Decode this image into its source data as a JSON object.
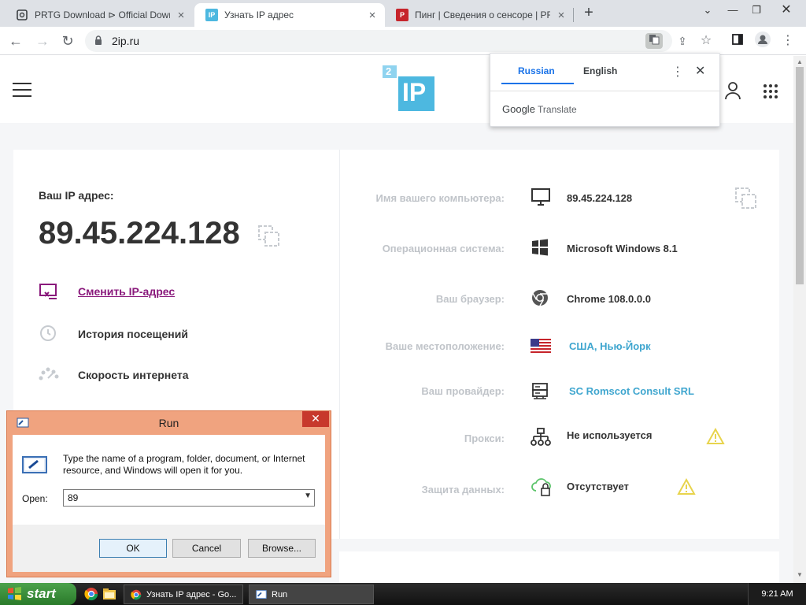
{
  "browser": {
    "tabs": [
      {
        "title": "PRTG Download ⊳ Official Down",
        "favicon": "prtg-icon",
        "active": false
      },
      {
        "title": "Узнать IP адрес",
        "favicon": "2ip-icon",
        "active": true
      },
      {
        "title": "Пинг | Сведения о сенсоре | PR",
        "favicon": "prtg-red-icon",
        "active": false
      }
    ],
    "url": "2ip.ru"
  },
  "translate_popup": {
    "lang_selected": "Russian",
    "lang_other": "English",
    "brand": "Google",
    "product": "Translate"
  },
  "site": {
    "logo_text": "IP",
    "logo_badge": "2",
    "ip_label": "Ваш IP адрес:",
    "ip_value": "89.45.224.128",
    "menu": {
      "change_ip": "Сменить IP-адрес",
      "history": "История посещений",
      "speed": "Скорость интернета"
    },
    "details": [
      {
        "label": "Имя вашего компьютера:",
        "value": "89.45.224.128",
        "icon": "monitor-icon"
      },
      {
        "label": "Операционная система:",
        "value": "Microsoft Windows 8.1",
        "icon": "windows-icon"
      },
      {
        "label": "Ваш браузер:",
        "value": "Chrome 108.0.0.0",
        "icon": "chrome-icon"
      },
      {
        "label": "Ваше местоположение:",
        "value": "США, Нью-Йорк",
        "icon": "us-flag-icon"
      },
      {
        "label": "Ваш провайдер:",
        "value": "SC Romscot Consult SRL",
        "icon": "server-icon"
      },
      {
        "label": "Прокси:",
        "value": "Не используется",
        "icon": "network-icon"
      },
      {
        "label": "Защита данных:",
        "value": "Отсутствует",
        "icon": "cloud-lock-icon"
      }
    ]
  },
  "run_dialog": {
    "title": "Run",
    "description": "Type the name of a program, folder, document, or Internet resource, and Windows will open it for you.",
    "open_label": "Open:",
    "open_value": "89",
    "ok": "OK",
    "cancel": "Cancel",
    "browse": "Browse..."
  },
  "taskbar": {
    "start": "start",
    "tasks": [
      {
        "label": "Узнать IP адрес - Go...",
        "icon": "chrome-icon"
      },
      {
        "label": "Run",
        "icon": "run-icon"
      }
    ],
    "clock": "9:21 AM"
  },
  "colors": {
    "accent_purple": "#8a1a7c",
    "link_blue": "#3fa6cf",
    "warn_yellow": "#e8d44d",
    "logo_blue": "#4db8e0"
  }
}
